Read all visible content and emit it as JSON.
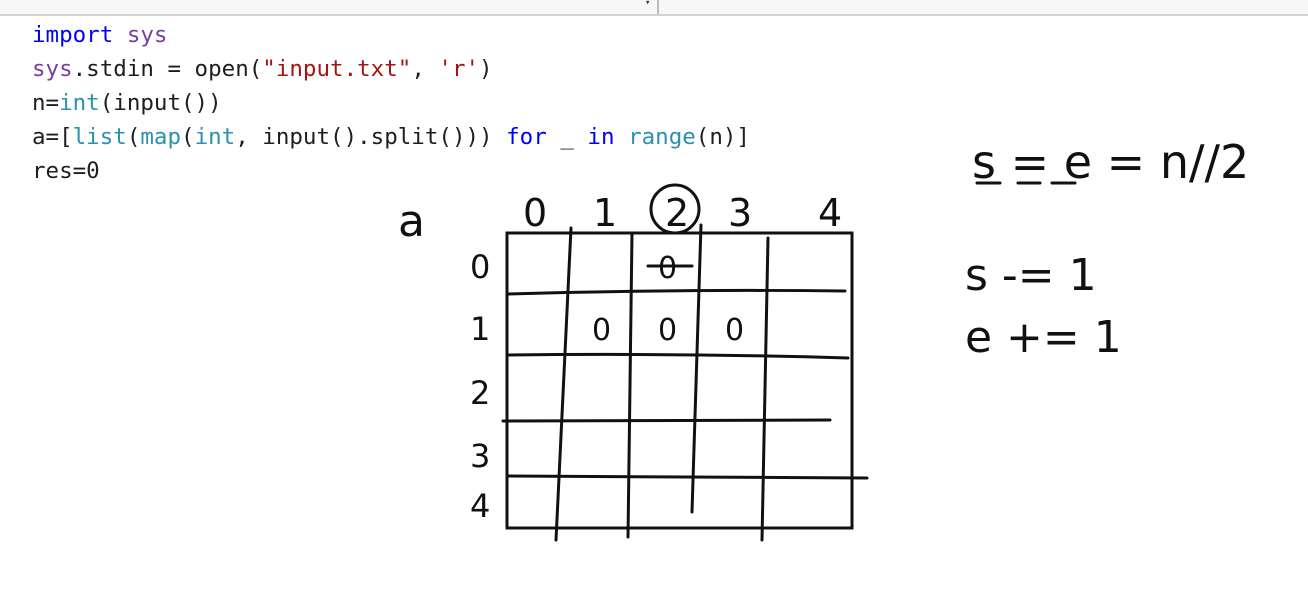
{
  "editor": {
    "lines": [
      [
        {
          "t": "import",
          "c": "kw"
        },
        {
          "t": " "
        },
        {
          "t": "sys",
          "c": "mod"
        }
      ],
      [
        {
          "t": "sys",
          "c": "mod"
        },
        {
          "t": ".stdin = open("
        },
        {
          "t": "\"input.txt\"",
          "c": "str"
        },
        {
          "t": ", "
        },
        {
          "t": "'r'",
          "c": "str"
        },
        {
          "t": ")"
        }
      ],
      [
        {
          "t": "n="
        },
        {
          "t": "int",
          "c": "bi"
        },
        {
          "t": "(input())"
        }
      ],
      [
        {
          "t": "a=["
        },
        {
          "t": "list",
          "c": "bi"
        },
        {
          "t": "("
        },
        {
          "t": "map",
          "c": "bi"
        },
        {
          "t": "("
        },
        {
          "t": "int",
          "c": "bi"
        },
        {
          "t": ", input().split())) "
        },
        {
          "t": "for",
          "c": "kw"
        },
        {
          "t": " _ "
        },
        {
          "t": "in",
          "c": "kw"
        },
        {
          "t": " "
        },
        {
          "t": "range",
          "c": "bi"
        },
        {
          "t": "(n)]"
        }
      ],
      [
        {
          "t": "res=0"
        }
      ]
    ]
  },
  "annotations": {
    "matrix_label": "a",
    "col_headers": [
      "0",
      "1",
      "2",
      "3",
      "4"
    ],
    "row_headers": [
      "0",
      "1",
      "2",
      "3",
      "4"
    ],
    "cells": [
      {
        "row": 0,
        "col": 2,
        "text": "0"
      },
      {
        "row": 1,
        "col": 1,
        "text": "0"
      },
      {
        "row": 1,
        "col": 2,
        "text": "0"
      },
      {
        "row": 1,
        "col": 3,
        "text": "0"
      }
    ],
    "formula": "s = e = n//2",
    "s_update": "s -= 1",
    "e_update": "e += 1"
  }
}
